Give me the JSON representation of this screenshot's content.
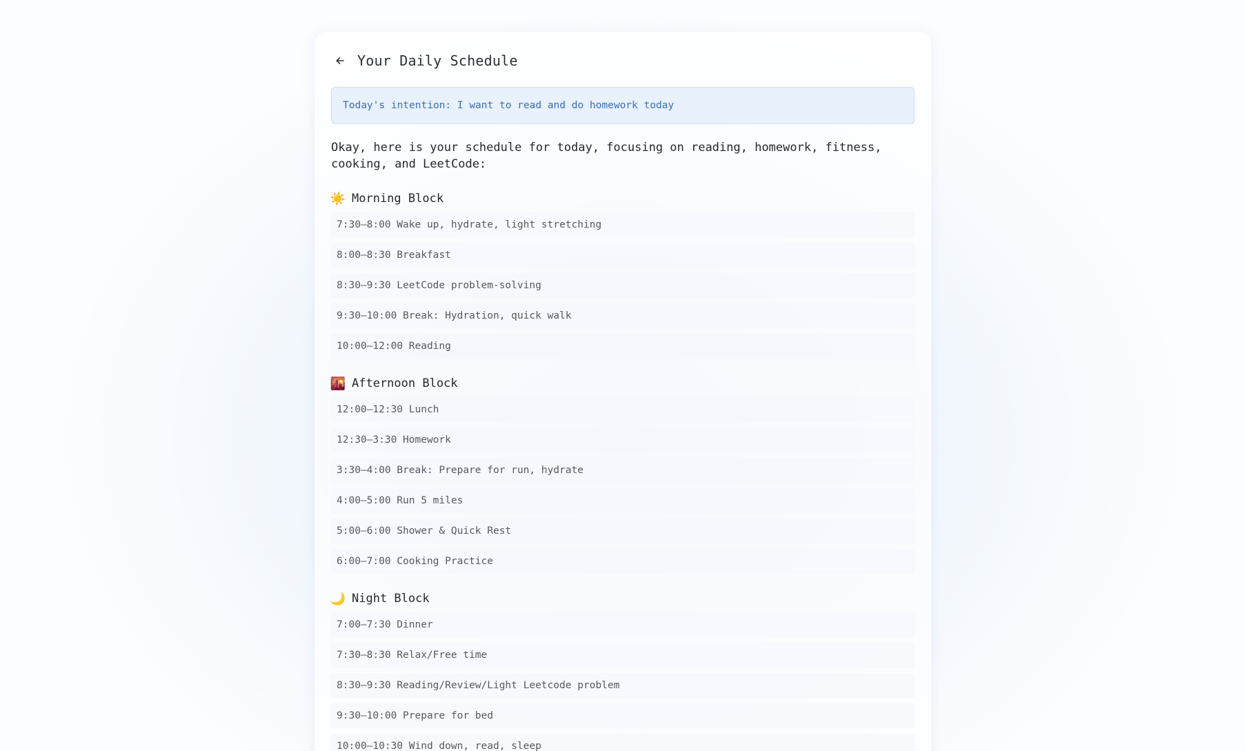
{
  "header": {
    "title": "Your Daily Schedule"
  },
  "intention": "Today's intention: I want to read and do homework today",
  "intro": "Okay, here is your schedule for today, focusing on reading, homework, fitness, cooking, and LeetCode:",
  "blocks": [
    {
      "emoji": "☀️",
      "title": "Morning Block",
      "items": [
        "7:30–8:00 Wake up, hydrate, light stretching",
        "8:00–8:30 Breakfast",
        "8:30–9:30 LeetCode problem-solving",
        "9:30–10:00 Break: Hydration, quick walk",
        "10:00–12:00 Reading"
      ]
    },
    {
      "emoji": "🌇",
      "title": "Afternoon Block",
      "items": [
        "12:00–12:30 Lunch",
        "12:30–3:30 Homework",
        "3:30–4:00 Break: Prepare for run, hydrate",
        "4:00–5:00 Run 5 miles",
        "5:00–6:00 Shower & Quick Rest",
        "6:00–7:00 Cooking Practice"
      ]
    },
    {
      "emoji": "🌙",
      "title": "Night Block",
      "items": [
        "7:00–7:30 Dinner",
        "7:30–8:30 Relax/Free time",
        "8:30–9:30 Reading/Review/Light Leetcode problem",
        "9:30–10:00 Prepare for bed",
        "10:00–10:30 Wind down, read, sleep"
      ]
    }
  ]
}
